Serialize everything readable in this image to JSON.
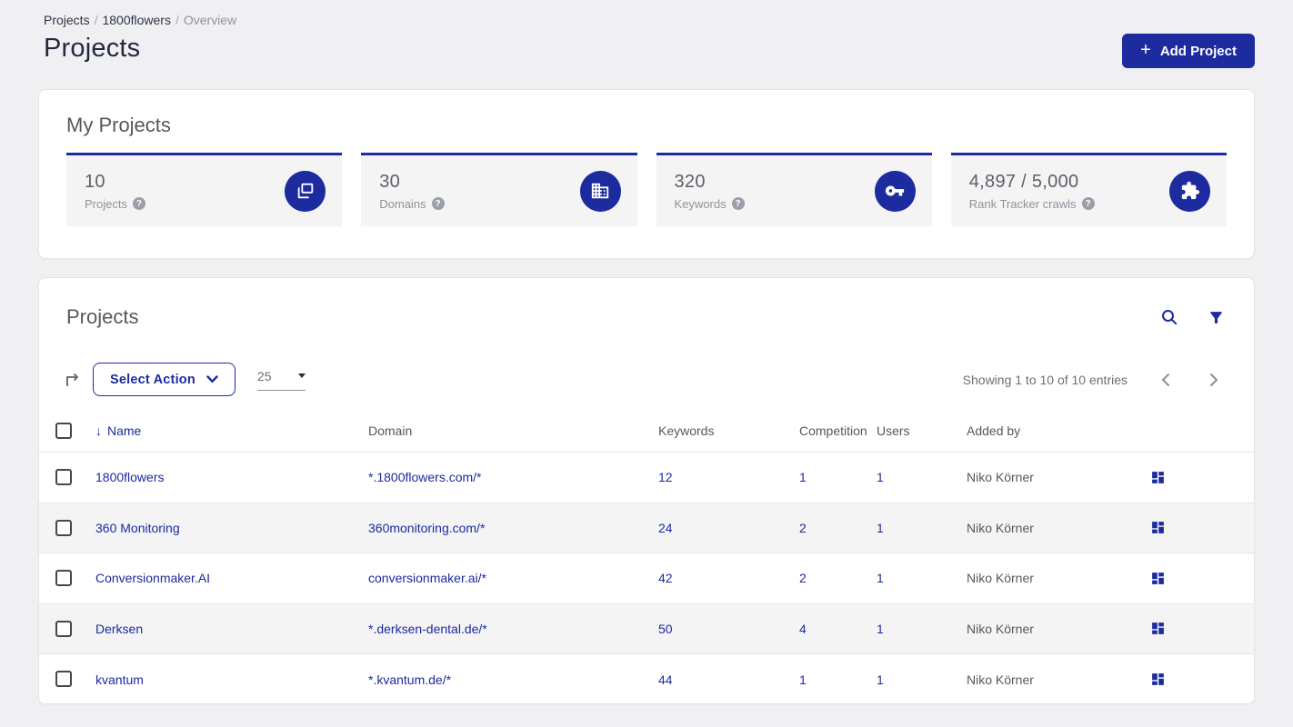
{
  "colors": {
    "primary_blue": "#1c2b9e",
    "page_background": "#f0f0f2",
    "card_background": "#ffffff",
    "row_alt_background": "#f4f4f5",
    "text_dark": "#222940",
    "text_gray": "#55585e"
  },
  "icons": {
    "help_glyph": "?",
    "plus_glyph": "+",
    "sort_down_glyph": "↓"
  },
  "breadcrumb": {
    "items": [
      "Projects",
      "1800flowers",
      "Overview"
    ],
    "separator": "/"
  },
  "header": {
    "page_title": "Projects",
    "add_project_label": "Add Project"
  },
  "my_projects": {
    "title": "My Projects",
    "stats": [
      {
        "value": "10",
        "label": "Projects",
        "icon": "stacked-projects-icon"
      },
      {
        "value": "30",
        "label": "Domains",
        "icon": "domain-building-icon"
      },
      {
        "value": "320",
        "label": "Keywords",
        "icon": "key-icon"
      },
      {
        "value": "4,897 / 5,000",
        "label": "Rank Tracker crawls",
        "icon": "puzzle-icon"
      }
    ]
  },
  "projects_panel": {
    "title": "Projects",
    "select_action_label": "Select Action",
    "page_size": "25",
    "showing_text": "Showing 1 to 10 of 10 entries",
    "columns": [
      "Name",
      "Domain",
      "Keywords",
      "Competition",
      "Users",
      "Added by"
    ],
    "rows": [
      {
        "name": "1800flowers",
        "domain": "*.1800flowers.com/*",
        "keywords": "12",
        "competition": "1",
        "users": "1",
        "added_by": "Niko Körner"
      },
      {
        "name": "360 Monitoring",
        "domain": "360monitoring.com/*",
        "keywords": "24",
        "competition": "2",
        "users": "1",
        "added_by": "Niko Körner"
      },
      {
        "name": "Conversionmaker.AI",
        "domain": "conversionmaker.ai/*",
        "keywords": "42",
        "competition": "2",
        "users": "1",
        "added_by": "Niko Körner"
      },
      {
        "name": "Derksen",
        "domain": "*.derksen-dental.de/*",
        "keywords": "50",
        "competition": "4",
        "users": "1",
        "added_by": "Niko Körner"
      },
      {
        "name": "kvantum",
        "domain": "*.kvantum.de/*",
        "keywords": "44",
        "competition": "1",
        "users": "1",
        "added_by": "Niko Körner"
      }
    ]
  }
}
